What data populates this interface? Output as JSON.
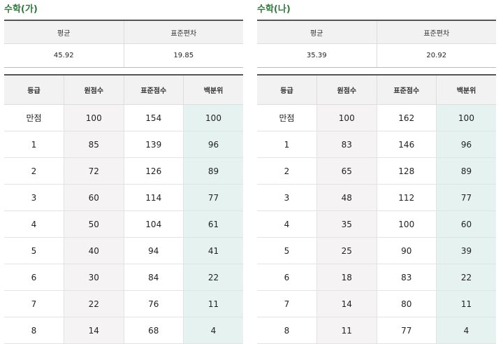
{
  "panels": [
    {
      "title": "수학(가)",
      "summary": {
        "headers": [
          "평균",
          "표준편차"
        ],
        "values": [
          "45.92",
          "19.85"
        ]
      },
      "grades": {
        "headers": [
          "등급",
          "원점수",
          "표준점수",
          "백분위"
        ],
        "rows": [
          [
            "만점",
            "100",
            "154",
            "100"
          ],
          [
            "1",
            "85",
            "139",
            "96"
          ],
          [
            "2",
            "72",
            "126",
            "89"
          ],
          [
            "3",
            "60",
            "114",
            "77"
          ],
          [
            "4",
            "50",
            "104",
            "61"
          ],
          [
            "5",
            "40",
            "94",
            "41"
          ],
          [
            "6",
            "30",
            "84",
            "22"
          ],
          [
            "7",
            "22",
            "76",
            "11"
          ],
          [
            "8",
            "14",
            "68",
            "4"
          ]
        ]
      }
    },
    {
      "title": "수학(나)",
      "summary": {
        "headers": [
          "평균",
          "표준편차"
        ],
        "values": [
          "35.39",
          "20.92"
        ]
      },
      "grades": {
        "headers": [
          "등급",
          "원점수",
          "표준점수",
          "백분위"
        ],
        "rows": [
          [
            "만점",
            "100",
            "162",
            "100"
          ],
          [
            "1",
            "83",
            "146",
            "96"
          ],
          [
            "2",
            "65",
            "128",
            "89"
          ],
          [
            "3",
            "48",
            "112",
            "77"
          ],
          [
            "4",
            "35",
            "100",
            "60"
          ],
          [
            "5",
            "25",
            "90",
            "39"
          ],
          [
            "6",
            "18",
            "83",
            "22"
          ],
          [
            "7",
            "14",
            "80",
            "11"
          ],
          [
            "8",
            "11",
            "77",
            "4"
          ]
        ]
      }
    }
  ],
  "colors": {
    "title": "#2e7a3a",
    "raw_column": "#f6f3f5",
    "percentile_column": "#e6f2ef",
    "header_bg": "#f2f2f2"
  }
}
